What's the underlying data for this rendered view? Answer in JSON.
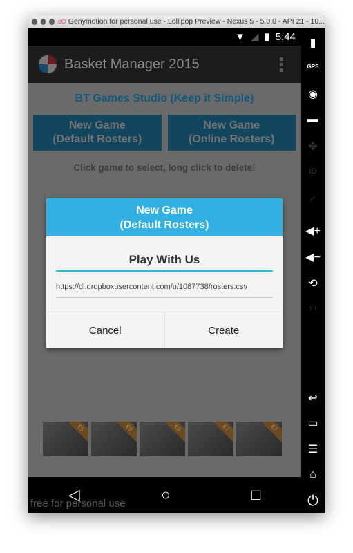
{
  "window": {
    "title": "Genymotion for personal use - Lollipop Preview - Nexus 5 - 5.0.0 - API 21 - 10..."
  },
  "status": {
    "time": "5:44"
  },
  "appbar": {
    "title": "Basket Manager 2015"
  },
  "main": {
    "studio": "BT Games Studio (Keep it Simple)",
    "buttons": [
      "New Game\n(Default Rosters)",
      "New Game\n(Online Rosters)"
    ],
    "hint": "Click game to select, long click to delete!",
    "ads": [
      "€5",
      "€9",
      "€9",
      "€7",
      "€7"
    ]
  },
  "dialog": {
    "title": "New Game\n(Default Rosters)",
    "name_value": "Play With Us",
    "url_value": "https://dl.dropboxusercontent.com/u/1087738/rosters.csv",
    "cancel": "Cancel",
    "create": "Create"
  },
  "watermark": "free for personal use",
  "sidebar": {
    "gps": "GPS",
    "id": "ID",
    "scale": "1:1"
  },
  "colors": {
    "accent": "#33b0e2",
    "button": "#12465e"
  }
}
